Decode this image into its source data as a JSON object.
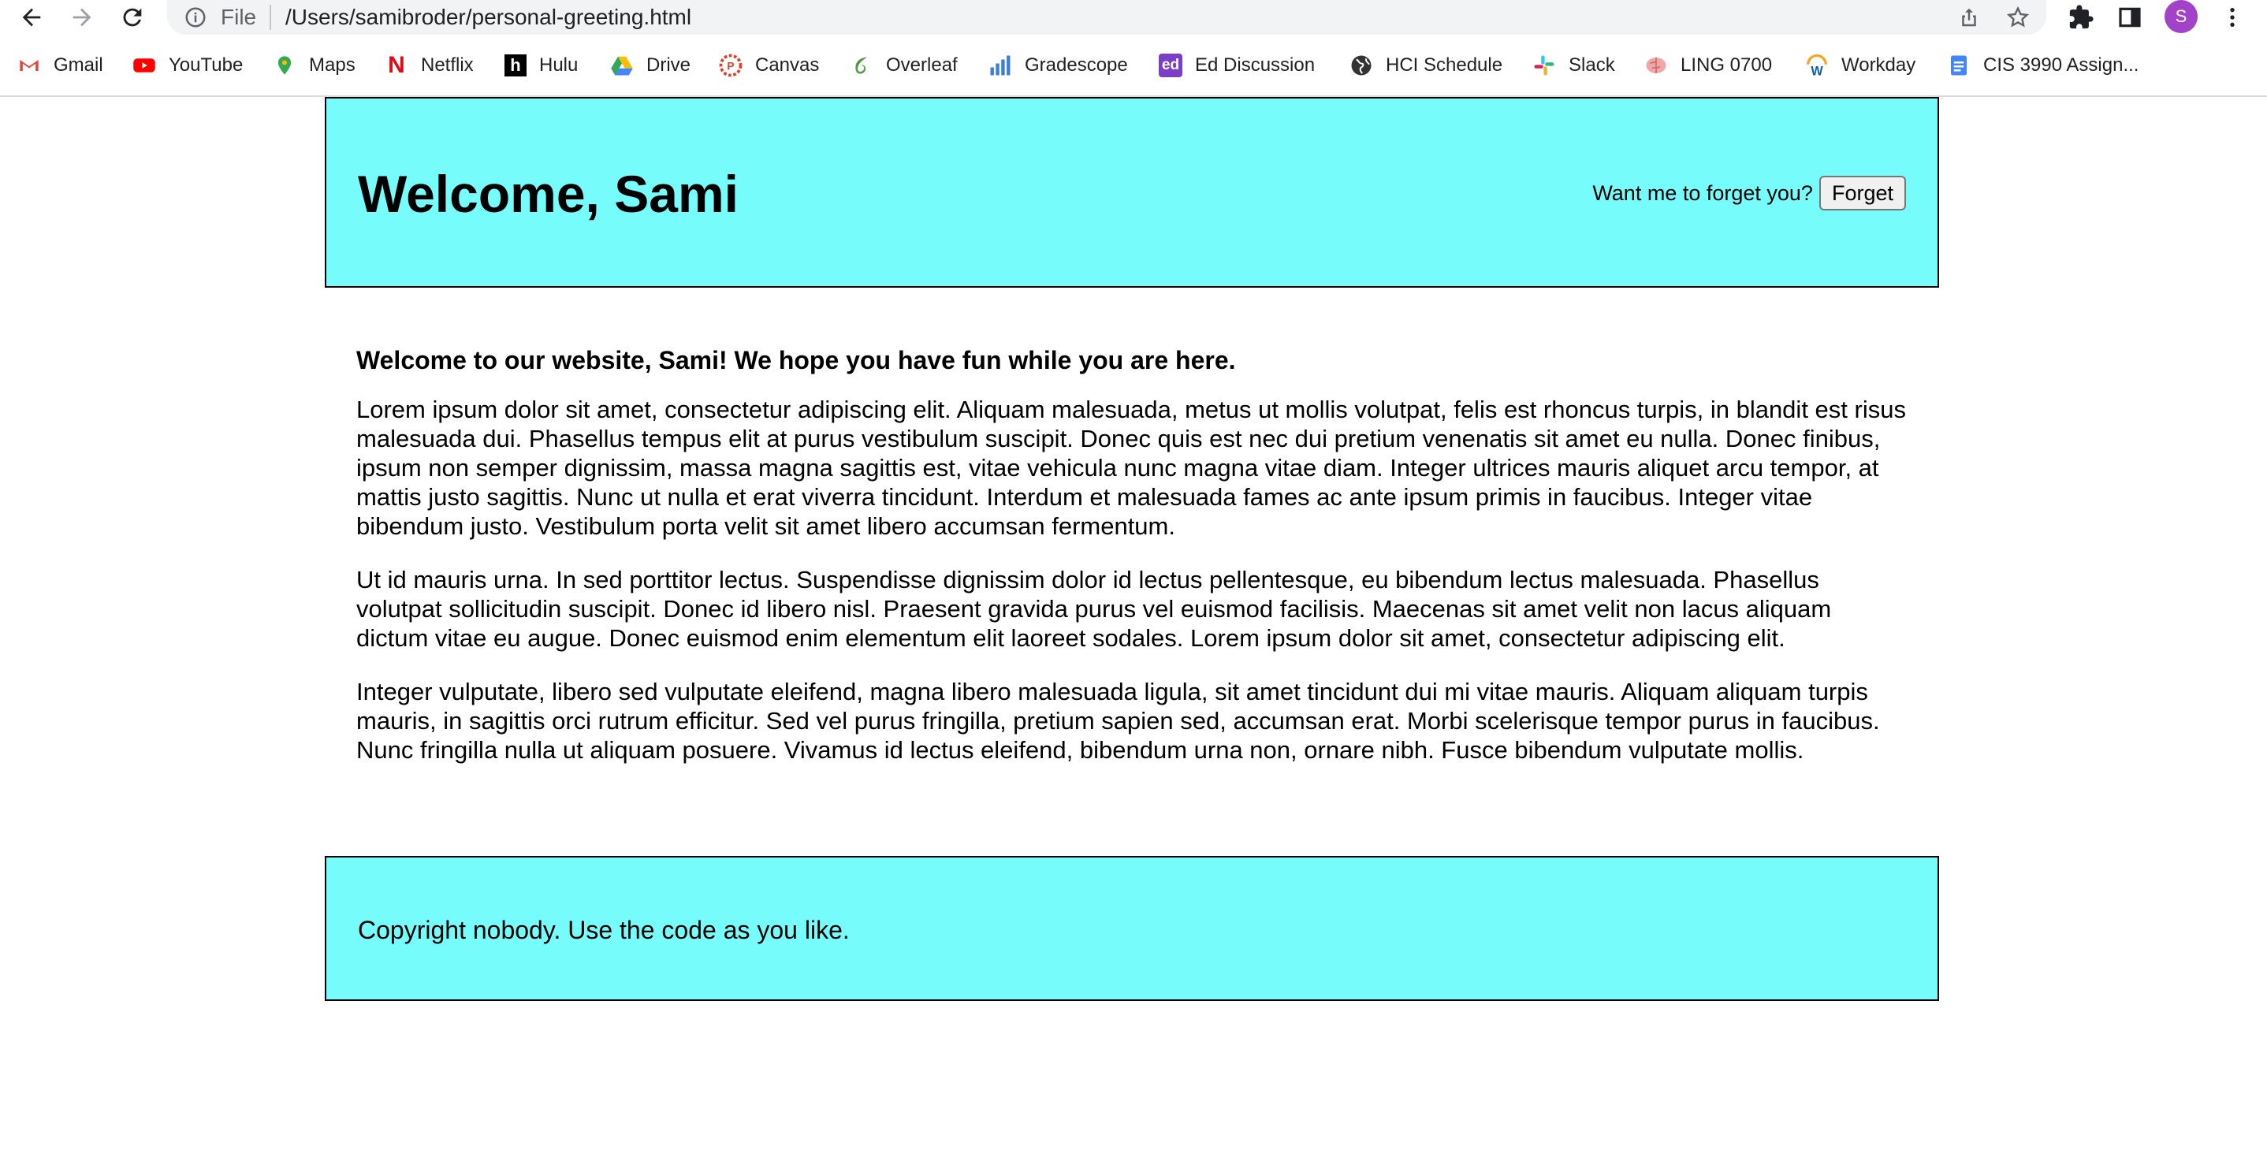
{
  "browser": {
    "file_label": "File",
    "url": "/Users/samibroder/personal-greeting.html",
    "avatar_initial": "S"
  },
  "bookmarks": [
    {
      "label": "Gmail",
      "icon": "gmail-icon",
      "color": "#ea4335"
    },
    {
      "label": "YouTube",
      "icon": "youtube-icon",
      "color": "#ff0000"
    },
    {
      "label": "Maps",
      "icon": "maps-icon",
      "color": "#34a853"
    },
    {
      "label": "Netflix",
      "icon": "netflix-icon",
      "color": "#e50914"
    },
    {
      "label": "Hulu",
      "icon": "hulu-icon",
      "color": "#000000"
    },
    {
      "label": "Drive",
      "icon": "drive-icon",
      "color": "#4285f4"
    },
    {
      "label": "Canvas",
      "icon": "canvas-icon",
      "color": "#e13f2b"
    },
    {
      "label": "Overleaf",
      "icon": "overleaf-icon",
      "color": "#4f9c45"
    },
    {
      "label": "Gradescope",
      "icon": "gradescope-icon",
      "color": "#3b7ddd"
    },
    {
      "label": "Ed Discussion",
      "icon": "ed-icon",
      "color": "#7b3fc4"
    },
    {
      "label": "HCI Schedule",
      "icon": "globe-icon",
      "color": "#333333"
    },
    {
      "label": "Slack",
      "icon": "slack-icon",
      "color": "#e01e5a"
    },
    {
      "label": "LING 0700",
      "icon": "brain-icon",
      "color": "#e79a9a"
    },
    {
      "label": "Workday",
      "icon": "workday-icon",
      "color": "#f5a623"
    },
    {
      "label": "CIS 3990 Assign...",
      "icon": "docs-icon",
      "color": "#4285f4"
    }
  ],
  "header": {
    "title": "Welcome, Sami",
    "forget_prompt": "Want me to forget you?",
    "forget_button": "Forget",
    "background": "#77fcfc"
  },
  "main": {
    "intro": "Welcome to our website, Sami! We hope you have fun while you are here.",
    "paragraphs": [
      "Lorem ipsum dolor sit amet, consectetur adipiscing elit. Aliquam malesuada, metus ut mollis volutpat, felis est rhoncus turpis, in blandit est risus malesuada dui. Phasellus tempus elit at purus vestibulum suscipit. Donec quis est nec dui pretium venenatis sit amet eu nulla. Donec finibus, ipsum non semper dignissim, massa magna sagittis est, vitae vehicula nunc magna vitae diam. Integer ultrices mauris aliquet arcu tempor, at mattis justo sagittis. Nunc ut nulla et erat viverra tincidunt. Interdum et malesuada fames ac ante ipsum primis in faucibus. Integer vitae bibendum justo. Vestibulum porta velit sit amet libero accumsan fermentum.",
      "Ut id mauris urna. In sed porttitor lectus. Suspendisse dignissim dolor id lectus pellentesque, eu bibendum lectus malesuada. Phasellus volutpat sollicitudin suscipit. Donec id libero nisl. Praesent gravida purus vel euismod facilisis. Maecenas sit amet velit non lacus aliquam dictum vitae eu augue. Donec euismod enim elementum elit laoreet sodales. Lorem ipsum dolor sit amet, consectetur adipiscing elit.",
      "Integer vulputate, libero sed vulputate eleifend, magna libero malesuada ligula, sit amet tincidunt dui mi vitae mauris. Aliquam aliquam turpis mauris, in sagittis orci rutrum efficitur. Sed vel purus fringilla, pretium sapien sed, accumsan erat. Morbi scelerisque tempor purus in faucibus. Nunc fringilla nulla ut aliquam posuere. Vivamus id lectus eleifend, bibendum urna non, ornare nibh. Fusce bibendum vulputate mollis."
    ]
  },
  "footer": {
    "text": "Copyright nobody. Use the code as you like."
  }
}
